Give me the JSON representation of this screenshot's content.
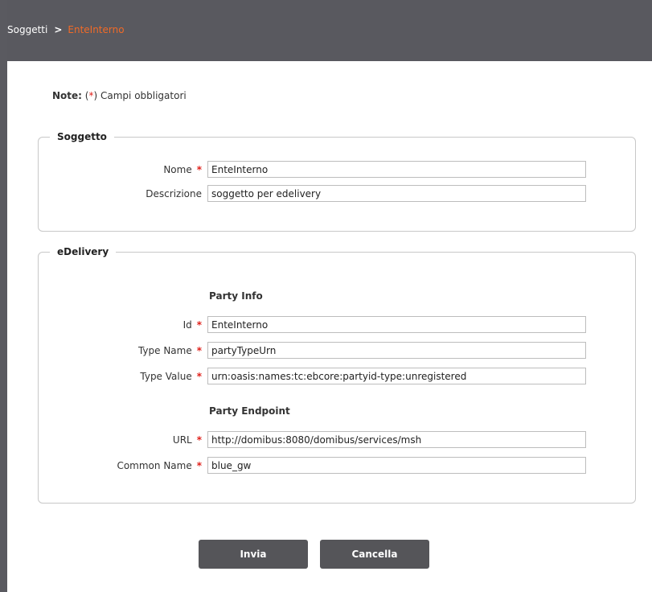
{
  "breadcrumb": {
    "root": "Soggetti",
    "separator": ">",
    "current": "EnteInterno"
  },
  "note": {
    "label": "Note:",
    "open": "(",
    "star": "*",
    "close": ")",
    "text": "Campi obbligatori"
  },
  "required_marker": "*",
  "soggetto": {
    "legend": "Soggetto",
    "nome": {
      "label": "Nome",
      "value": "EnteInterno",
      "required": true
    },
    "descrizione": {
      "label": "Descrizione",
      "value": "soggetto per edelivery",
      "required": false
    }
  },
  "edelivery": {
    "legend": "eDelivery",
    "party_info": {
      "heading": "Party Info",
      "id": {
        "label": "Id",
        "value": "EnteInterno",
        "required": true
      },
      "type_name": {
        "label": "Type Name",
        "value": "partyTypeUrn",
        "required": true
      },
      "type_value": {
        "label": "Type Value",
        "value": "urn:oasis:names:tc:ebcore:partyid-type:unregistered",
        "required": true
      }
    },
    "party_endpoint": {
      "heading": "Party Endpoint",
      "url": {
        "label": "URL",
        "value": "http://domibus:8080/domibus/services/msh",
        "required": true
      },
      "common_name": {
        "label": "Common Name",
        "value": "blue_gw",
        "required": true
      }
    }
  },
  "buttons": {
    "submit": "Invia",
    "cancel": "Cancella"
  },
  "colors": {
    "header": "#59595f",
    "accent": "#f06a28",
    "required": "#e0201a",
    "button": "#555559",
    "border": "#c8c8c8"
  }
}
